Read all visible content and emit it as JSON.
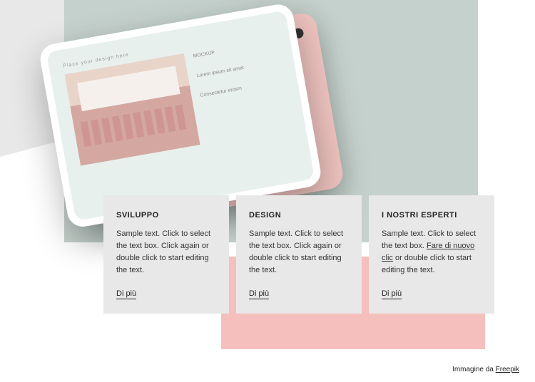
{
  "mockup": {
    "placeholder_label": "Place your design here",
    "sidebar_heading": "MOCKUP",
    "sidebar_text1": "Lorem ipsum sit amet",
    "sidebar_text2": "Consectetur erosm"
  },
  "cards": [
    {
      "title": "SVILUPPO",
      "body": "Sample text. Click to select the text box. Click again or double click to start editing the text.",
      "link": "Di più"
    },
    {
      "title": "DESIGN",
      "body": "Sample text. Click to select the text box. Click again or double click to start editing the text.",
      "link": "Di più"
    },
    {
      "title": "I NOSTRI ESPERTI",
      "body_before": "Sample text. Click to select the text box. ",
      "body_link": "Fare di nuovo clic",
      "body_after": " or double click to start editing the text.",
      "link": "Di più"
    }
  ],
  "credit": {
    "prefix": "Immagine da ",
    "link_text": "Freepik"
  }
}
